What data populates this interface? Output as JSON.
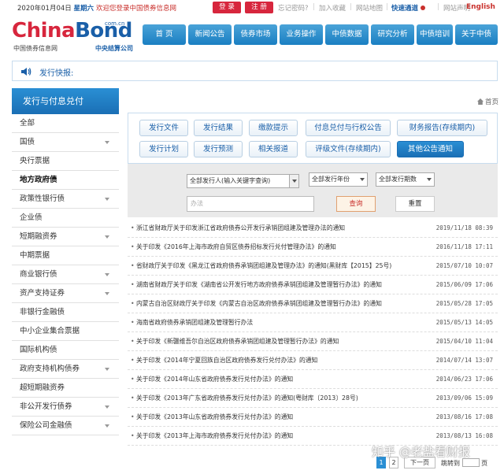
{
  "topbar": {
    "date": "2020年01月04日",
    "weekday": "星期六",
    "welcome": "欢迎您登录中国债券信息网",
    "login": "登 录",
    "register": "注 册",
    "forgot": "忘记密码?",
    "favorite": "加入收藏",
    "sitemap": "网站地图",
    "quick": "快速通道",
    "statement": "网站声明",
    "english": "English"
  },
  "logo": {
    "china": "China",
    "bond": "Bond",
    "comcn": "com.cn",
    "cn_left": "中国债券信息网",
    "cn_right": "中央结算公司"
  },
  "nav": [
    "首 页",
    "新闻公告",
    "债券市场",
    "业务操作",
    "中债数据",
    "研究分析",
    "中债培训",
    "关于中债"
  ],
  "flash": {
    "label": "发行快报:"
  },
  "sidebar": {
    "title": "发行与付息兑付",
    "items": [
      {
        "label": "全部",
        "arrow": false,
        "active": false
      },
      {
        "label": "国债",
        "arrow": true,
        "active": false
      },
      {
        "label": "央行票据",
        "arrow": false,
        "active": false
      },
      {
        "label": "地方政府债",
        "arrow": false,
        "active": true
      },
      {
        "label": "政策性银行债",
        "arrow": true,
        "active": false
      },
      {
        "label": "企业债",
        "arrow": false,
        "active": false
      },
      {
        "label": "短期融资券",
        "arrow": true,
        "active": false
      },
      {
        "label": "中期票据",
        "arrow": false,
        "active": false
      },
      {
        "label": "商业银行债",
        "arrow": true,
        "active": false
      },
      {
        "label": "资产支持证券",
        "arrow": true,
        "active": false
      },
      {
        "label": "非银行金融债",
        "arrow": false,
        "active": false
      },
      {
        "label": "中小企业集合票据",
        "arrow": false,
        "active": false
      },
      {
        "label": "国际机构债",
        "arrow": false,
        "active": false
      },
      {
        "label": "政府支持机构债券",
        "arrow": true,
        "active": false
      },
      {
        "label": "超短期融资券",
        "arrow": false,
        "active": false
      },
      {
        "label": "非公开发行债券",
        "arrow": true,
        "active": false
      },
      {
        "label": "保险公司金融债",
        "arrow": true,
        "active": false
      }
    ]
  },
  "home_link": "首页",
  "categories": {
    "row1": [
      "发行文件",
      "发行结果",
      "缴款提示",
      "付息兑付与行权公告",
      "财务报告(存续期内)"
    ],
    "row2": [
      "发行计划",
      "发行预测",
      "相关报道",
      "评级文件(存续期内)",
      "其他公告通知"
    ],
    "active": "其他公告通知"
  },
  "filter": {
    "issuer": "全部发行人(输入关键字查询)",
    "year": "全部发行年份",
    "term": "全部发行期数",
    "search_placeholder": "办法",
    "query_button": "查询",
    "reset_button": "重置"
  },
  "announcements": [
    {
      "title": "浙江省财政厅关于印发浙江省政府债券公开发行承销团组建及管理办法的通知",
      "date": "2019/11/18 08:39"
    },
    {
      "title": "关于印发《2016年上海市政府自贸区债券招标发行兑付管理办法》的通知",
      "date": "2016/11/18 17:11"
    },
    {
      "title": "省财政厅关于印发《黑龙江省政府债券承销团组建及管理办法》的通知(黑财库【2015】25号)",
      "date": "2015/07/10 10:07"
    },
    {
      "title": "湖南省财政厅关于印发《湖南省公开发行地方政府债券承销团组建及管理暂行办法》的通知",
      "date": "2015/06/09 17:06"
    },
    {
      "title": "内蒙古自治区财政厅关于印发《内蒙古自治区政府债券承销团组建及管理暂行办法》的通知",
      "date": "2015/05/28 17:05"
    },
    {
      "title": "海南省政府债券承销团组建及管理暂行办法",
      "date": "2015/05/13 14:05"
    },
    {
      "title": "关于印发《新疆维吾尔自治区政府债券承销团组建及管理暂行办法》的通知",
      "date": "2015/04/10 11:04"
    },
    {
      "title": "关于印发《2014年宁夏回族自治区政府债券发行兑付办法》的通知",
      "date": "2014/07/14 13:07"
    },
    {
      "title": "关于印发《2014年山东省政府债券发行兑付办法》的通知",
      "date": "2014/06/23 17:06"
    },
    {
      "title": "关于印发《2013年广东省政府债券发行兑付办法》的通知(粤财库〔2013〕28号)",
      "date": "2013/09/06 15:09"
    },
    {
      "title": "关于印发《2013年山东省政府债券发行兑付办法》的通知",
      "date": "2013/08/16 17:08"
    },
    {
      "title": "关于印发《2013年上海市政府债券发行兑付办法》的通知",
      "date": "2013/08/13 16:08"
    }
  ],
  "pager": {
    "p1": "1",
    "p2": "2",
    "next": "下一页",
    "jump": "跳转到",
    "page_unit": "页"
  },
  "watermark": "知乎 @老盐看财报"
}
